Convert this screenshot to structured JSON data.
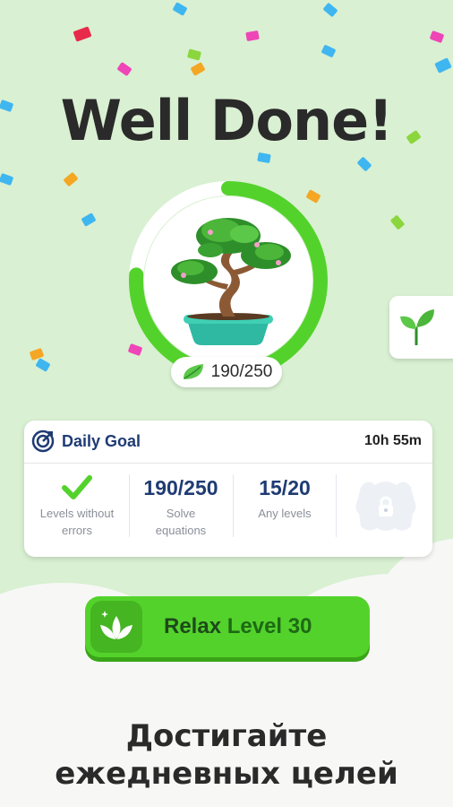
{
  "title": "Well Done!",
  "tree": {
    "progress_text": "190/250",
    "progress_fraction": 0.76
  },
  "daily_goal": {
    "title": "Daily Goal",
    "time_left": "10h 55m",
    "goals": [
      {
        "value": "",
        "status": "completed",
        "label_line1": "Levels without",
        "label_line2": "errors"
      },
      {
        "value": "190/250",
        "label_line1": "Solve",
        "label_line2": "equations"
      },
      {
        "value": "15/20",
        "label_line1": "Any levels",
        "label_line2": ""
      }
    ],
    "reward": {
      "state": "locked"
    }
  },
  "play_button": {
    "word": "Relax",
    "level": "Level 30"
  },
  "footer": {
    "line1": "Достигайте",
    "line2": "ежедневных целей"
  },
  "colors": {
    "accent": "#54d22c",
    "background": "#d9f0d2",
    "navy": "#1f3b73"
  }
}
